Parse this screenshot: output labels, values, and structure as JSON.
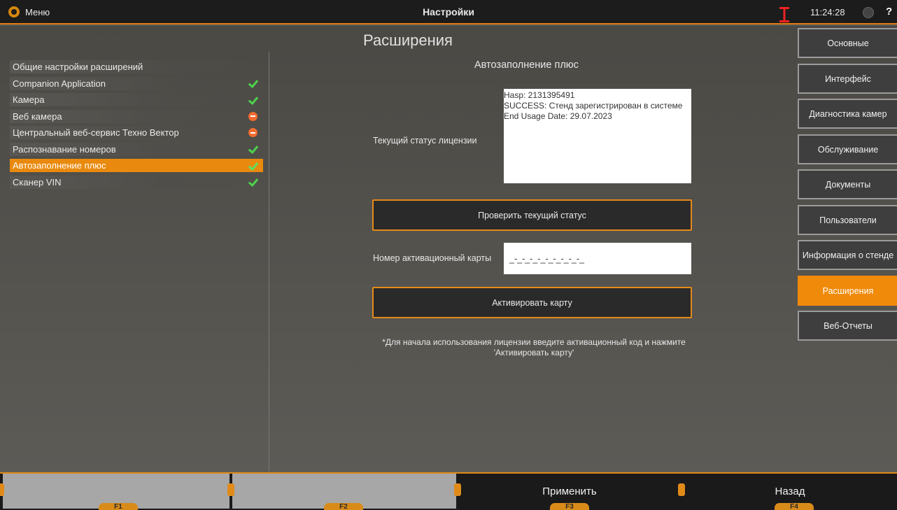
{
  "topbar": {
    "menu_label": "Меню",
    "title": "Настройки",
    "clock": "11:24:28",
    "help_label": "?"
  },
  "page": {
    "heading": "Расширения"
  },
  "extensions": [
    {
      "label": "Общие настройки расширений",
      "status": ""
    },
    {
      "label": "Companion Application",
      "status": "ok"
    },
    {
      "label": "Камера",
      "status": "ok"
    },
    {
      "label": "Веб камера",
      "status": "error"
    },
    {
      "label": "Центральный веб-сервис Техно Вектор",
      "status": "error"
    },
    {
      "label": "Распознавание номеров",
      "status": "ok"
    },
    {
      "label": "Автозаполнение плюс",
      "status": "ok",
      "active": true
    },
    {
      "label": "Сканер VIN",
      "status": "ok"
    }
  ],
  "panel": {
    "title": "Автозаполнение плюс",
    "license_label": "Текущий статус лицензии",
    "license_lines": [
      "Hasp: 2131395491",
      "SUCCESS: Стенд зарегистрирован в системе",
      "End Usage Date: 29.07.2023"
    ],
    "check_button": "Проверить текущий статус",
    "card_label": "Номер активационный карты",
    "card_value": "_-_-_-_-_-_-_-_-_-_",
    "activate_button": "Активировать карту",
    "hint": "*Для начала использования лицензии введите активационный код и нажмите 'Активировать карту'"
  },
  "nav": {
    "items": [
      {
        "label": "Основные"
      },
      {
        "label": "Интерфейс"
      },
      {
        "label": "Диагностика камер"
      },
      {
        "label": "Обслуживание"
      },
      {
        "label": "Документы"
      },
      {
        "label": "Пользователи"
      },
      {
        "label": "Информация о стенде"
      },
      {
        "label": "Расширения",
        "active": true
      },
      {
        "label": "Веб-Отчеты"
      }
    ]
  },
  "fkeys": [
    {
      "key": "F1",
      "label": "",
      "enabled": false
    },
    {
      "key": "F2",
      "label": "",
      "enabled": false
    },
    {
      "key": "F3",
      "label": "Применить",
      "enabled": true
    },
    {
      "key": "F4",
      "label": "Назад",
      "enabled": true
    }
  ],
  "colors": {
    "accent": "#f08a0a",
    "ok": "#4cd24c",
    "error": "#f36b2f"
  }
}
